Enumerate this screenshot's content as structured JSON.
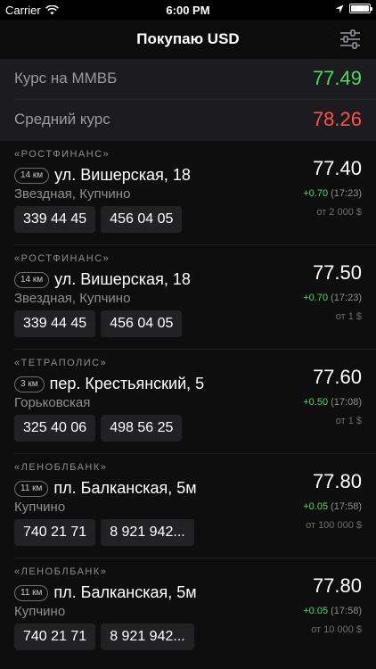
{
  "status_bar": {
    "carrier": "Carrier",
    "time": "6:00 PM",
    "battery_level": 1.0
  },
  "nav": {
    "title": "Покупаю USD",
    "filter_icon": "sliders-icon"
  },
  "rates": [
    {
      "label": "Курс на ММВБ",
      "value": "77.49",
      "color": "#4cd964"
    },
    {
      "label": "Средний курс",
      "value": "78.26",
      "color": "#ff4f4f"
    }
  ],
  "offers": [
    {
      "bank": "«РОСТФИНАНС»",
      "distance": "14 км",
      "address": "ул. Вишерская, 18",
      "metro": "Звездная, Купчино",
      "phones": [
        "339 44 45",
        "456 04 05"
      ],
      "price": "77.40",
      "delta": "+0.70",
      "time": "(17:23)",
      "min_amount": "от 2 000 $"
    },
    {
      "bank": "«РОСТФИНАНС»",
      "distance": "14 км",
      "address": "ул. Вишерская, 18",
      "metro": "Звездная, Купчино",
      "phones": [
        "339 44 45",
        "456 04 05"
      ],
      "price": "77.50",
      "delta": "+0.70",
      "time": "(17:23)",
      "min_amount": "от 1 $"
    },
    {
      "bank": "«ТЕТРАПОЛИС»",
      "distance": "3 км",
      "address": "пер. Крестьянский, 5",
      "metro": "Горьковская",
      "phones": [
        "325 40 06",
        "498 56 25"
      ],
      "price": "77.60",
      "delta": "+0.50",
      "time": "(17:08)",
      "min_amount": "от 1 $"
    },
    {
      "bank": "«ЛЕНОБЛБАНК»",
      "distance": "11 км",
      "address": "пл. Балканская, 5м",
      "metro": "Купчино",
      "phones": [
        "740 21 71",
        "8 921 942..."
      ],
      "price": "77.80",
      "delta": "+0.05",
      "time": "(17:58)",
      "min_amount": "от 100 000 $"
    },
    {
      "bank": "«ЛЕНОБЛБАНК»",
      "distance": "11 км",
      "address": "пл. Балканская, 5м",
      "metro": "Купчино",
      "phones": [
        "740 21 71",
        "8 921 942..."
      ],
      "price": "77.80",
      "delta": "+0.05",
      "time": "(17:58)",
      "min_amount": "от 10 000 $"
    }
  ]
}
